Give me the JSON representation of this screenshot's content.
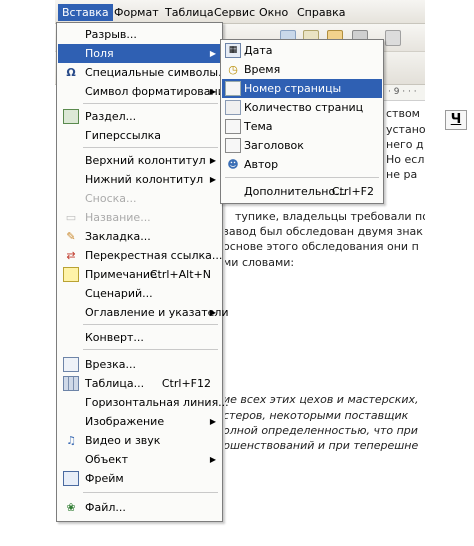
{
  "menubar": {
    "items": [
      "Вставка",
      "Формат",
      "Таблица",
      "Сервис",
      "Окно",
      "Справка"
    ],
    "active": "Вставка"
  },
  "toolbar": {
    "underline_label": "Ч",
    "ruler_text": "· 9 · · ·"
  },
  "insert_menu": {
    "items": [
      {
        "label": "Разрыв...",
        "icon": "",
        "enabled": true
      },
      {
        "label": "Поля",
        "icon": "",
        "submenu": true,
        "highlighted": true
      },
      {
        "label": "Специальные символы...",
        "icon": "omega-icon"
      },
      {
        "label": "Символ форматирования",
        "submenu": true
      },
      {
        "label": "Раздел...",
        "icon": "section-icon"
      },
      {
        "label": "Гиперссылка"
      },
      {
        "label": "Верхний колонтитул",
        "submenu": true
      },
      {
        "label": "Нижний колонтитул",
        "submenu": true
      },
      {
        "label": "Сноска...",
        "enabled": false
      },
      {
        "label": "Название...",
        "icon": "caption-icon",
        "enabled": false
      },
      {
        "label": "Закладка...",
        "icon": "bookmark-icon"
      },
      {
        "label": "Перекрестная ссылка...",
        "icon": "cross-reference-icon"
      },
      {
        "label": "Примечание",
        "icon": "note-icon",
        "shortcut": "Ctrl+Alt+N"
      },
      {
        "label": "Сценарий..."
      },
      {
        "label": "Оглавление и указатели",
        "submenu": true
      },
      {
        "label": "Конверт..."
      },
      {
        "label": "Врезка...",
        "icon": "frame-icon"
      },
      {
        "label": "Таблица...",
        "icon": "table-icon",
        "shortcut": "Ctrl+F12"
      },
      {
        "label": "Горизонтальная линия..."
      },
      {
        "label": "Изображение",
        "submenu": true
      },
      {
        "label": "Видео и звук",
        "icon": "media-icon"
      },
      {
        "label": "Объект",
        "submenu": true
      },
      {
        "label": "Фрейм",
        "icon": "floating-frame-icon"
      },
      {
        "label": "Файл...",
        "icon": "file-icon"
      }
    ]
  },
  "fields_menu": {
    "items": [
      {
        "label": "Дата",
        "icon": "date-icon"
      },
      {
        "label": "Время",
        "icon": "clock-icon"
      },
      {
        "label": "Номер страницы",
        "icon": "page-number-icon",
        "highlighted": true
      },
      {
        "label": "Количество страниц",
        "icon": "page-count-icon"
      },
      {
        "label": "Тема",
        "icon": "subject-icon"
      },
      {
        "label": "Заголовок",
        "icon": "title-icon"
      },
      {
        "label": "Автор",
        "icon": "author-icon"
      },
      {
        "label": "Дополнительно...",
        "shortcut": "Ctrl+F2"
      }
    ]
  },
  "document": {
    "lines": [
      "ством",
      "устано",
      "него д",
      "Но есл",
      "не ра",
      "тупике, владельцы требовали пов",
      "завод был обследован двумя знак",
      "основе этого обследования они п",
      "ми словами:",
      "ие всех этих цехов и мастерских,",
      "стеров, некоторыми поставщик",
      "олной определенностью, что при",
      "ршенствований и при теперешне"
    ]
  }
}
